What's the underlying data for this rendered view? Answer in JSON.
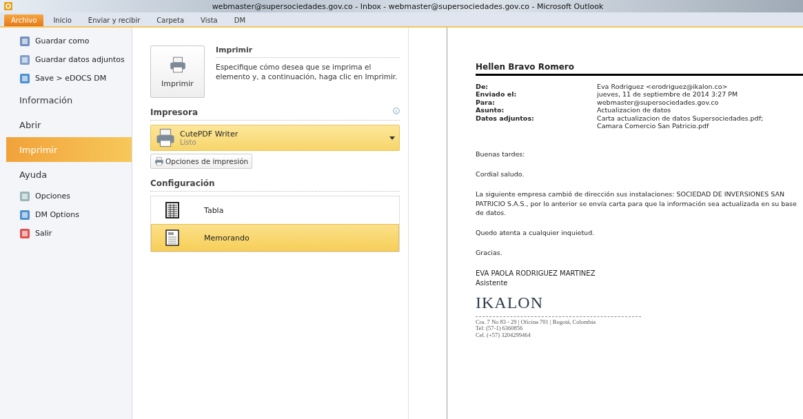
{
  "window": {
    "title": "webmaster@supersociedades.gov.co - Inbox - webmaster@supersociedades.gov.co  -  Microsoft Outlook"
  },
  "ribbon_tabs": [
    {
      "label": "Archivo",
      "selected": true
    },
    {
      "label": "Inicio",
      "selected": false
    },
    {
      "label": "Enviar y recibir",
      "selected": false
    },
    {
      "label": "Carpeta",
      "selected": false
    },
    {
      "label": "Vista",
      "selected": false
    },
    {
      "label": "DM",
      "selected": false
    }
  ],
  "sidebar": {
    "items": [
      {
        "kind": "command",
        "label": "Guardar como",
        "selected": false
      },
      {
        "kind": "command",
        "label": "Guardar datos adjuntos",
        "selected": false
      },
      {
        "kind": "command",
        "label": "Save > eDOCS DM",
        "selected": false
      },
      {
        "kind": "section",
        "label": "Información",
        "selected": false
      },
      {
        "kind": "section",
        "label": "Abrir",
        "selected": false
      },
      {
        "kind": "section",
        "label": "Imprimir",
        "selected": true
      },
      {
        "kind": "section",
        "label": "Ayuda",
        "selected": false
      },
      {
        "kind": "command",
        "label": "Opciones",
        "selected": false
      },
      {
        "kind": "command",
        "label": "DM Options",
        "selected": false
      },
      {
        "kind": "command",
        "label": "Salir",
        "selected": false
      }
    ]
  },
  "print": {
    "button": "Imprimir",
    "heading": "Imprimir",
    "description": "Especifique cómo desea que se imprima el elemento y, a continuación, haga clic en Imprimir.",
    "printer_heading": "Impresora",
    "printer": {
      "name": "CutePDF Writer",
      "status": "Listo"
    },
    "options_button": "Opciones de impresión",
    "settings_heading": "Configuración",
    "styles": [
      {
        "label": "Tabla",
        "selected": false
      },
      {
        "label": "Memorando",
        "selected": true
      }
    ]
  },
  "preview": {
    "sender_name": "Hellen Bravo Romero",
    "fields": [
      {
        "label": "De:",
        "value": "Eva Rodriguez <erodriguez@ikalon.co>"
      },
      {
        "label": "Enviado el:",
        "value": "jueves, 11 de septiembre de 2014 3:27 PM"
      },
      {
        "label": "Para:",
        "value": "webmaster@supersociedades.gov.co"
      },
      {
        "label": "Asunto:",
        "value": "Actualizacion de datos"
      },
      {
        "label": "Datos adjuntos:",
        "value": "Carta actualizacion de datos Supersociedades.pdf; Camara Comercio San Patricio.pdf"
      }
    ],
    "paragraphs": [
      "Buenas tardes:",
      "Cordial saludo.",
      "La siguiente empresa cambió de dirección sus instalaciones: SOCIEDAD DE INVERSIONES SAN PATRICIO S.A.S., por lo anterior se envía carta para que la información sea actualizada en su base de datos.",
      "Quedo atenta a cualquier inquietud.",
      "Gracias."
    ],
    "signature_name": "EVA PAOLA RODRIGUEZ MARTINEZ",
    "signature_title": "Asistente",
    "logo": "IKALON",
    "address_lines": [
      "Cra. 7 No 83 - 29 | Oficina 701 | Bogotá, Colombia",
      "Tel: (57-1) 6360856",
      "Cel. (+57) 3204299464"
    ]
  }
}
